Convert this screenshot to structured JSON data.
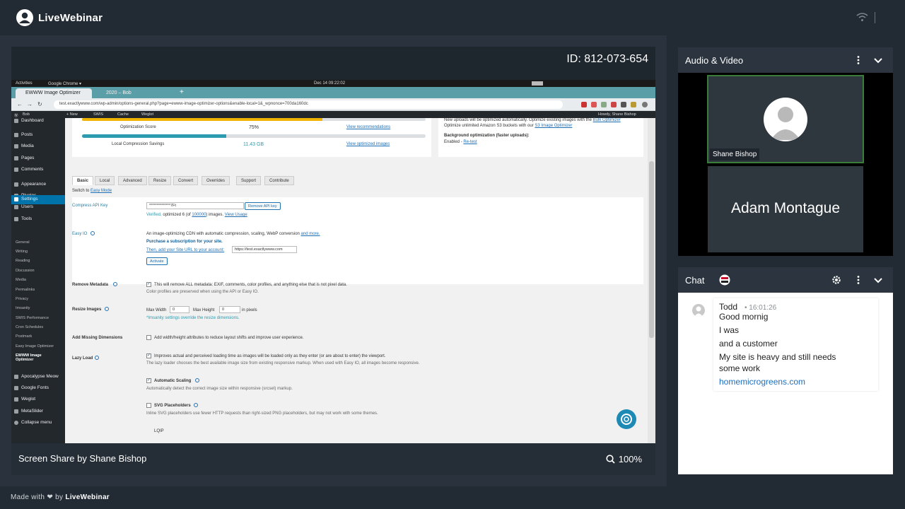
{
  "app": {
    "brand": "LiveWebinar"
  },
  "stage": {
    "meeting_id": "ID: 812-073-654",
    "share_label": "Screen Share by Shane Bishop",
    "zoom": "100%"
  },
  "shared_screen": {
    "os": {
      "activities": "Activities",
      "browser_menu": "Google Chrome ▾",
      "clock": "Dec 14  09:22:02"
    },
    "browser": {
      "tabs": [
        {
          "label": "EWWW Image Optimizer",
          "active": true
        },
        {
          "label": "2020 – Bob",
          "active": false
        }
      ],
      "url": "test.exactlywww.com/wp-admin/options-general.php?page=ewww-image-optimizer-options&enable-local=1&_wpnonce=700da160dc"
    },
    "wp_admin_bar": {
      "site": "Bob",
      "new": "+ New",
      "items": [
        "SWIS",
        "Cache",
        "Weglot"
      ],
      "howdy": "Howdy, Shane Bishop"
    },
    "sidebar": {
      "top": [
        {
          "label": "Dashboard",
          "y": 0
        },
        {
          "label": "Posts"
        },
        {
          "label": "Media"
        },
        {
          "label": "Pages"
        },
        {
          "label": "Comments"
        },
        {
          "label": "Appearance"
        },
        {
          "label": "Plugins"
        },
        {
          "label": "Users"
        },
        {
          "label": "Tools"
        },
        {
          "label": "Settings"
        }
      ],
      "sub": [
        "General",
        "Writing",
        "Reading",
        "Discussion",
        "Media",
        "Permalinks",
        "Privacy",
        "Imsanity",
        "SWIS Performance",
        "Cron Schedules",
        "Postmark",
        "Easy Image Optimizer"
      ],
      "current_sub": "EWWW Image Optimizer",
      "bottom": [
        "Apocalypse Meow",
        "Google Fonts",
        "Weglot",
        "MetaSlider",
        "Collapse menu"
      ]
    },
    "optimizer": {
      "score_label": "Optimization Score",
      "score_value": "75%",
      "score_fraction": 0.75,
      "score_link": "View recommendations",
      "savings_label": "Local Compression Savings",
      "savings_value": "11.43 GB",
      "savings_fraction": 0.42,
      "savings_link": "View optimized images",
      "side_note_1": "New uploads will be optimized automatically. Optimize existing images with the",
      "side_note_link_1": "Bulk Optimizer",
      "side_note_2": "Optimize unlimited Amazon S3 buckets with our",
      "side_note_link_2": "S3 Image Optimizer",
      "bg_opt_label": "Background optimization (faster uploads):",
      "bg_opt_value": "Enabled",
      "bg_opt_link": "Re-test"
    },
    "tabs": [
      "Basic",
      "Local",
      "Advanced",
      "Resize",
      "Convert",
      "Overrides",
      "Support",
      "Contribute"
    ],
    "switch_to": "Switch to",
    "easy_mode": "Easy Mode",
    "compress_api": {
      "label": "Compress API Key",
      "value": "**************7Ft",
      "remove_btn": "Remove API key",
      "verified": "Verified,",
      "optimized_text": "optimized 6 (of",
      "optimized_link": "100000",
      "optimized_tail": ") images.",
      "usage_link": "View Usage"
    },
    "easy_io": {
      "label": "Easy IO",
      "desc": "An image-optimizing CDN with automatic compression, scaling, WebP conversion",
      "more": "and more.",
      "purchase": "Purchase a subscription for your site.",
      "then_add": "Then, add your Site URL to your account:",
      "site_url": "https://test.exactlywww.com",
      "activate": "Activate"
    },
    "remove_metadata": {
      "label": "Remove Metadata",
      "desc": "This will remove ALL metadata: EXIF, comments, color profiles, and anything else that is not pixel data.",
      "note": "Color profiles are preserved when using the API or Easy IO."
    },
    "resize_images": {
      "label": "Resize Images",
      "max_width_label": "Max Width",
      "max_width": "0",
      "max_height_label": "Max Height",
      "max_height": "0",
      "unit": "in pixels",
      "note": "*Imsanity settings override the resize dimensions."
    },
    "missing_dims": {
      "label": "Add Missing Dimensions",
      "desc": "Add width/height attributes to reduce layout shifts and improve user experience."
    },
    "lazy_load": {
      "label": "Lazy Load",
      "desc": "Improves actual and perceived loading time as images will be loaded only as they enter (or are about to enter) the viewport.",
      "note": "The lazy loader chooses the best available image size from existing responsive markup. When used with Easy IO, all images become responsive.",
      "auto_scaling": "Automatic Scaling",
      "auto_note": "Automatically detect the correct image size within responsive (srcset) markup.",
      "svg_placeholders": "SVG Placeholders",
      "svg_note": "Inline SVG placeholders use fewer HTTP requests than right-sized PNG placeholders, but may not work with some themes.",
      "lqip": "LQIP"
    }
  },
  "audio_video": {
    "title": "Audio & Video",
    "participant_1": "Shane Bishop",
    "participant_2": "Adam Montague"
  },
  "chat": {
    "title": "Chat",
    "messages": [
      {
        "author": "Todd",
        "time": "16:01:26",
        "lines": [
          "Good mornig",
          "I was",
          "and a customer",
          "My site is heavy and still needs",
          "some work"
        ],
        "link": "homemicrogreens.com"
      }
    ]
  },
  "footer": {
    "made_with": "Made with",
    "by": "by",
    "brand": "LiveWebinar"
  },
  "colors": {
    "accent_blue": "#0073aa",
    "progress": "#2c9bb0",
    "active_speaker": "#3a7d3a",
    "background": "#222a33"
  }
}
